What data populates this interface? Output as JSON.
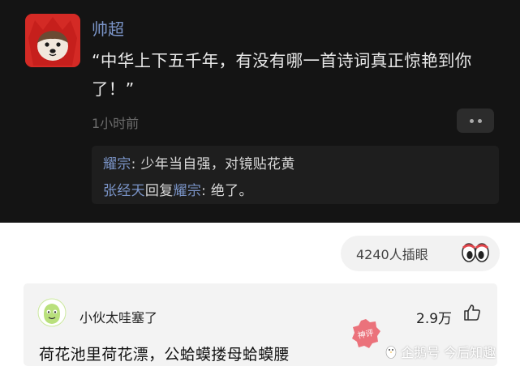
{
  "main_comment": {
    "username": "帅超",
    "text": "“中华上下五千年，有没有哪一首诗词真正惊艳到你了！”",
    "time": "1小时前",
    "more_icon": "more-dots-icon"
  },
  "replies": [
    {
      "name": "耀宗",
      "sep": ": ",
      "text": "少年当自强，对镜贴花黄"
    },
    {
      "name": "张经天",
      "verb": "回复",
      "target": "耀宗",
      "sep": ": ",
      "text": "绝了。"
    }
  ],
  "reaction": {
    "count_label": "4240人插眼",
    "icon": "eyes-icon"
  },
  "card": {
    "username": "小伙太哇塞了",
    "likes": "2.9万",
    "like_icon": "thumbs-up-icon",
    "text": "荷花池里荷花漂，公蛤蟆搂母蛤蟆腰"
  },
  "watermark": {
    "text": "企鹅号 今后知趣",
    "stamp_text": "神评"
  },
  "colors": {
    "name_blue": "#7b95c9",
    "dark_bg": "#141414",
    "stamp_red": "#e94b57"
  }
}
